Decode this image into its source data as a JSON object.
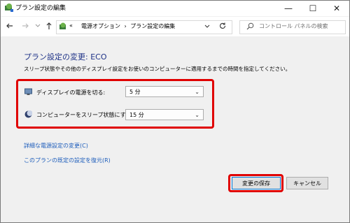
{
  "window": {
    "title": "プラン設定の編集",
    "controls": {
      "minimize": "—",
      "maximize": "☐",
      "close": "✕"
    }
  },
  "nav": {
    "breadcrumb_prefix": "«",
    "breadcrumb": [
      "電源オプション",
      "プラン設定の編集"
    ],
    "separator": "›",
    "search_placeholder": "コントロール パネルの検索"
  },
  "main": {
    "heading": "プラン設定の変更: ECO",
    "description": "スリープ状態やその他のディスプレイ設定をお使いのコンピューターに適用するまでの時間を指定してください。",
    "settings": [
      {
        "label": "ディスプレイの電源を切る:",
        "value": "5 分",
        "icon": "monitor-icon"
      },
      {
        "label": "コンピューターをスリープ状態にする:",
        "value": "15 分",
        "icon": "moon-icon"
      }
    ],
    "links": {
      "advanced": "詳細な電源設定の変更(C)",
      "restore": "このプランの既定の設定を復元(R)"
    },
    "buttons": {
      "save": "変更の保存",
      "cancel": "キャンセル"
    }
  },
  "colors": {
    "accent_heading": "#1e3287",
    "highlight": "#e00000",
    "link": "#1d5dbb"
  }
}
